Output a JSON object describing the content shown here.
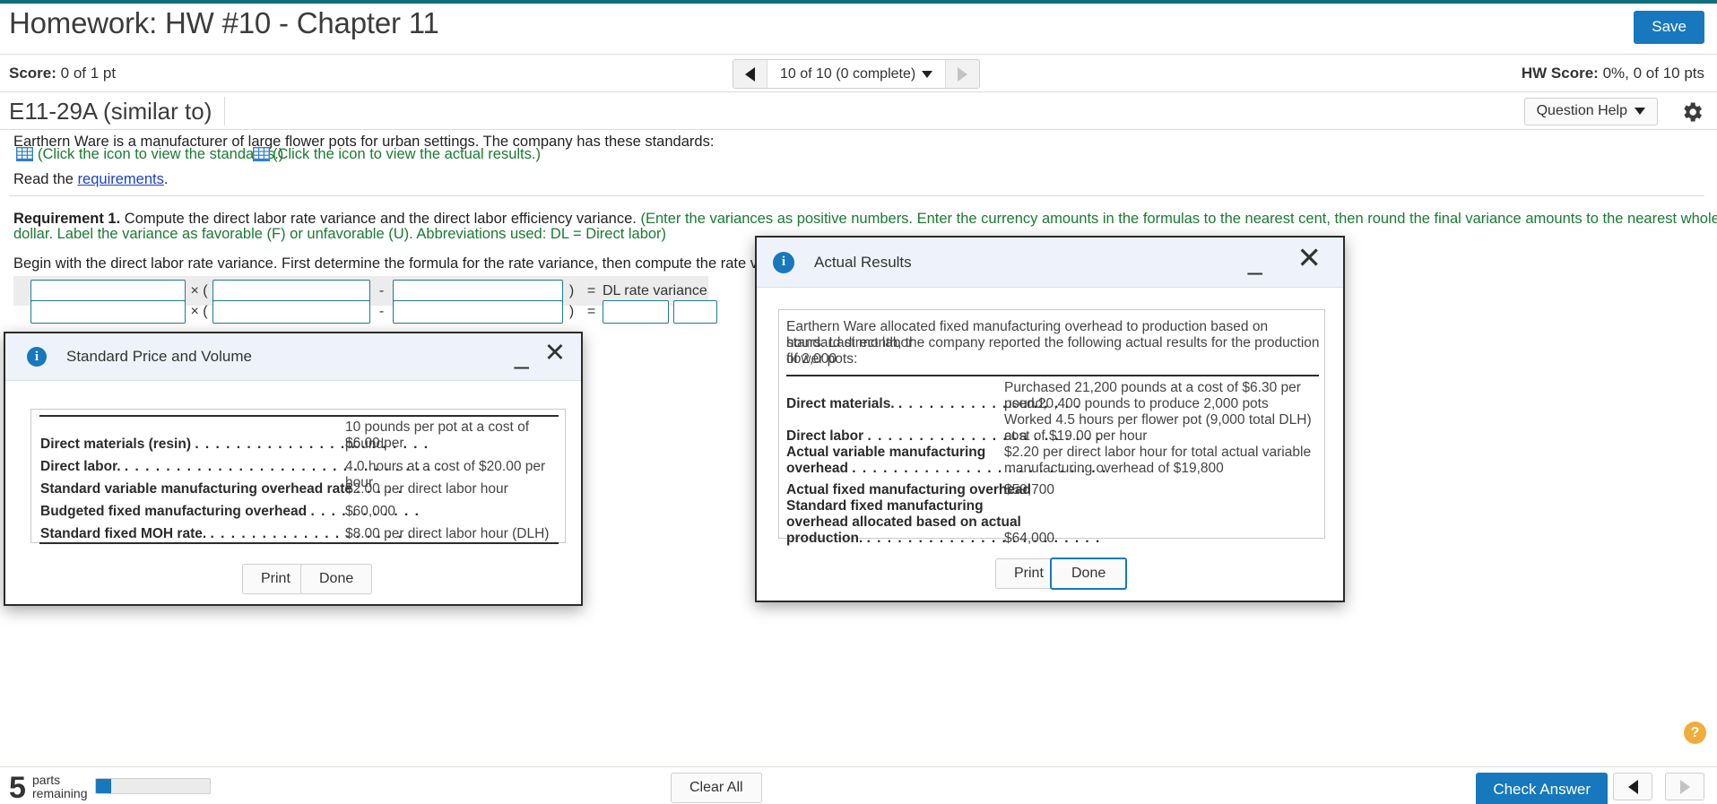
{
  "header": {
    "title": "Homework: HW #10 - Chapter 11",
    "save_label": "Save",
    "accent_color": "#11707f"
  },
  "scorebar": {
    "score_label": "Score:",
    "score_value": "0 of 1 pt",
    "pager_label": "10 of 10 (0 complete)",
    "hw_score_label": "HW Score:",
    "hw_score_value": "0%, 0 of 10 pts"
  },
  "exercise_bar": {
    "exercise_id": "E11-29A (similar to)",
    "question_help_label": "Question Help",
    "gear_icon": "gear-icon"
  },
  "problem": {
    "intro": "Earthern Ware is a manufacturer of large flower pots for urban settings. The company has these standards:",
    "standards_link": "(Click the icon to view the standards.)",
    "actual_link": "(Click the icon to view the actual results.)",
    "read_prefix": "Read the ",
    "requirements_link": "requirements",
    "read_suffix": ".",
    "req_title": "Requirement 1.",
    "req_black": " Compute the direct labor rate variance and the direct labor efficiency variance.",
    "req_green_line1": " (Enter the variances as positive numbers. Enter the currency amounts in the formulas to the nearest cent, then round the final variance amounts to the nearest whole",
    "req_green_line2": "dollar. Label the variance as favorable (F) or unfavorable (U). Abbreviations used: DL = Direct labor)",
    "begin_line": "Begin with the direct labor rate variance. First determine the formula for the rate variance, then compute the rate variance for direct labor.",
    "formula": {
      "multiply": "× (",
      "minus": "-",
      "close_paren": ")",
      "equals": "=",
      "result_label": "DL rate variance",
      "row1_inputs": [
        "",
        "",
        ""
      ],
      "row2_inputs": [
        "",
        "",
        "",
        "",
        ""
      ]
    }
  },
  "dialog_standards": {
    "title": "Standard Price and Volume",
    "info_icon": "info-icon",
    "minimize_icon": "minimize-icon",
    "close_icon": "close-icon",
    "rows": [
      {
        "label": "Direct materials (resin)",
        "dots": ". . . . . . . . . . . . . . . . . . . . . . .",
        "value_line1": "10 pounds per pot at a cost of $6.00 per",
        "value_line2": "pound"
      },
      {
        "label": "Direct labor.",
        "dots": ". . . . . . . . . . . . . . . . . . . . . . . . . . . . . . .",
        "value_line1": "",
        "value_line2": "4.0 hours at a cost of $20.00 per hour"
      },
      {
        "label": "Standard variable manufacturing overhead rate",
        "dots": ". . . . .",
        "value_line1": "",
        "value_line2": "$2.00 per direct labor hour"
      },
      {
        "label": "Budgeted fixed manufacturing overhead",
        "dots": ". . . . . . . . . . .",
        "value_line1": "",
        "value_line2": "$60,000"
      },
      {
        "label": "Standard fixed MOH rate.",
        "dots": ". . . . . . . . . . . . . . . . . . . . .",
        "value_line1": "",
        "value_line2": "$8.00 per direct labor hour (DLH)"
      }
    ],
    "print_label": "Print",
    "done_label": "Done"
  },
  "dialog_actual": {
    "title": "Actual Results",
    "info_icon": "info-icon",
    "minimize_icon": "minimize-icon",
    "close_icon": "close-icon",
    "intro_l1": "Earthern Ware allocated fixed manufacturing overhead to production based on standard direct labor",
    "intro_l2": "hours. Last month, the company reported the following actual results for the production of 2,000",
    "intro_l3": "flower pots:",
    "rows": [
      {
        "label": "Direct materials.",
        "dots": ". . . . . . . . . . . . . . . . . .",
        "value_line1": "Purchased 21,200 pounds at a cost of $6.30 per pound;",
        "value_line2": "used 20,400 pounds to produce 2,000 pots"
      },
      {
        "label": "Direct labor",
        "dots": ". . . . . . . . . . . . . . . . . . . . . . .",
        "value_line1": "Worked 4.5 hours per flower pot (9,000 total DLH) at a",
        "value_line2": "cost of $19.00 per hour"
      },
      {
        "label_l1": "Actual variable manufacturing",
        "label_l2": "overhead",
        "dots": ". . . . . . . . . . . . . . . . . . . . . . . . .",
        "value_line1": "$2.20 per direct labor hour for total actual variable",
        "value_line2": "manufacturing overhead of $19,800"
      },
      {
        "label": "Actual fixed manufacturing overhead",
        "dots": "",
        "value_line1": "$59,700",
        "value_line2": ""
      },
      {
        "label_l1": "Standard fixed manufacturing",
        "label_l2": "overhead allocated based on actual",
        "label_l3": "production.",
        "dots": ". . . . . . . . . . . . . . . . . . . . . . .",
        "value_line1": "",
        "value_line2": "$64,000"
      }
    ],
    "print_label": "Print",
    "done_label": "Done"
  },
  "bottombar": {
    "parts_count": "5",
    "parts_label_l1": "parts",
    "parts_label_l2": "remaining",
    "progress_percent": 13,
    "clear_all_label": "Clear All",
    "check_answer_label": "Check Answer",
    "prev_icon": "triangle-left-icon",
    "next_icon": "triangle-right-icon",
    "help_icon": "question-mark-icon"
  }
}
